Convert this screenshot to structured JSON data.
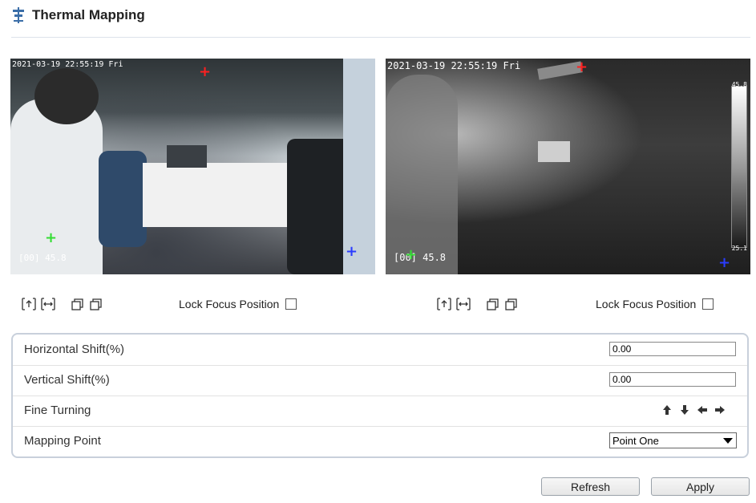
{
  "page": {
    "title": "Thermal Mapping",
    "title_icon": "thermal-mapping-icon"
  },
  "left_video": {
    "timestamp": "2021-03-19 22:55:19 Fri",
    "readout": "[00] 45.8",
    "markers": [
      {
        "name": "red-marker",
        "color": "#ff2020",
        "glyph": "+"
      },
      {
        "name": "green-marker",
        "color": "#33dd33",
        "glyph": "+"
      },
      {
        "name": "blue-marker",
        "color": "#2a3cff",
        "glyph": "+"
      }
    ]
  },
  "right_video": {
    "timestamp": "2021-03-19 22:55:19 Fri",
    "readout": "[00] 45.8",
    "scale_max": "45.8",
    "scale_min": "25.1",
    "markers": [
      {
        "name": "red-marker",
        "color": "#ff2020",
        "glyph": "+"
      },
      {
        "name": "green-marker",
        "color": "#33dd33",
        "glyph": "+"
      },
      {
        "name": "blue-marker",
        "color": "#2a3cff",
        "glyph": "+"
      }
    ]
  },
  "controls": {
    "lock_focus_label": "Lock Focus Position",
    "icons": [
      "zoom-in-icon",
      "zoom-out-icon",
      "window-icon",
      "window-restore-icon"
    ]
  },
  "form": {
    "horizontal_shift": {
      "label": "Horizontal Shift(%)",
      "value": "0.00"
    },
    "vertical_shift": {
      "label": "Vertical Shift(%)",
      "value": "0.00"
    },
    "fine_tuning": {
      "label": "Fine Turning",
      "icons": [
        "arrow-up-icon",
        "arrow-down-icon",
        "arrow-left-icon",
        "arrow-right-icon"
      ]
    },
    "mapping_point": {
      "label": "Mapping Point",
      "selected": "Point One"
    }
  },
  "buttons": {
    "refresh": "Refresh",
    "apply": "Apply"
  },
  "colors": {
    "accent_border": "#c8d0db",
    "marker_red": "#ff2020",
    "marker_green": "#33dd33",
    "marker_blue": "#2a3cff"
  }
}
